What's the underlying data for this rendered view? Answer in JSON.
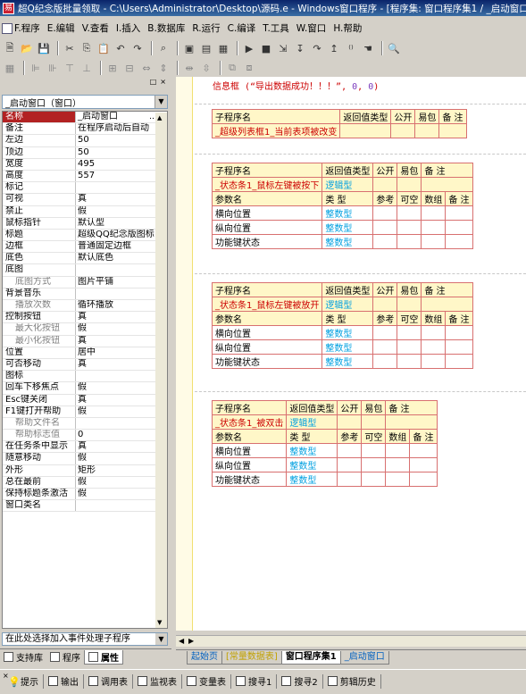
{
  "window": {
    "title": "超Q纪念版批量领取 - C:\\Users\\Administrator\\Desktop\\源码.e - Windows窗口程序 - [程序集: 窗口程序集1 / _启动窗口"
  },
  "menu": [
    {
      "label": "F.程序"
    },
    {
      "label": "E.编辑"
    },
    {
      "label": "V.查看"
    },
    {
      "label": "I.插入"
    },
    {
      "label": "B.数据库"
    },
    {
      "label": "R.运行"
    },
    {
      "label": "C.编译"
    },
    {
      "label": "T.工具"
    },
    {
      "label": "W.窗口"
    },
    {
      "label": "H.帮助"
    }
  ],
  "panel": {
    "combo_value": "_启动窗口（窗口）",
    "event_combo": "在此处选择加入事件处理子程序",
    "properties": [
      {
        "name": "名称",
        "value": "_启动窗口",
        "selected": true,
        "sub": false
      },
      {
        "name": "备注",
        "value": "在程序启动后自动",
        "selected": false,
        "sub": false
      },
      {
        "name": "左边",
        "value": "50",
        "selected": false,
        "sub": false
      },
      {
        "name": "顶边",
        "value": "50",
        "selected": false,
        "sub": false
      },
      {
        "name": "宽度",
        "value": "495",
        "selected": false,
        "sub": false
      },
      {
        "name": "高度",
        "value": "557",
        "selected": false,
        "sub": false
      },
      {
        "name": "标记",
        "value": "",
        "selected": false,
        "sub": false
      },
      {
        "name": "可视",
        "value": "真",
        "selected": false,
        "sub": false
      },
      {
        "name": "禁止",
        "value": "假",
        "selected": false,
        "sub": false
      },
      {
        "name": "鼠标指针",
        "value": "默认型",
        "selected": false,
        "sub": false
      },
      {
        "name": "标题",
        "value": "超级QQ纪念版图标",
        "selected": false,
        "sub": false
      },
      {
        "name": "边框",
        "value": "普通固定边框",
        "selected": false,
        "sub": false
      },
      {
        "name": "底色",
        "value": "默认底色",
        "selected": false,
        "sub": false
      },
      {
        "name": "底图",
        "value": "",
        "selected": false,
        "sub": false
      },
      {
        "name": "底图方式",
        "value": "图片平铺",
        "selected": false,
        "sub": true
      },
      {
        "name": "背景音乐",
        "value": "",
        "selected": false,
        "sub": false
      },
      {
        "name": "播放次数",
        "value": "循环播放",
        "selected": false,
        "sub": true
      },
      {
        "name": "控制按钮",
        "value": "真",
        "selected": false,
        "sub": false
      },
      {
        "name": "最大化按钮",
        "value": "假",
        "selected": false,
        "sub": true
      },
      {
        "name": "最小化按钮",
        "value": "真",
        "selected": false,
        "sub": true
      },
      {
        "name": "位置",
        "value": "居中",
        "selected": false,
        "sub": false
      },
      {
        "name": "可否移动",
        "value": "真",
        "selected": false,
        "sub": false
      },
      {
        "name": "图标",
        "value": "",
        "selected": false,
        "sub": false
      },
      {
        "name": "回车下移焦点",
        "value": "假",
        "selected": false,
        "sub": false
      },
      {
        "name": "Esc键关闭",
        "value": "真",
        "selected": false,
        "sub": false
      },
      {
        "name": "F1键打开帮助",
        "value": "假",
        "selected": false,
        "sub": false
      },
      {
        "name": "帮助文件名",
        "value": "",
        "selected": false,
        "sub": true
      },
      {
        "name": "帮助标志值",
        "value": "0",
        "selected": false,
        "sub": true
      },
      {
        "name": "在任务条中显示",
        "value": "真",
        "selected": false,
        "sub": false
      },
      {
        "name": "随意移动",
        "value": "假",
        "selected": false,
        "sub": false
      },
      {
        "name": "外形",
        "value": "矩形",
        "selected": false,
        "sub": false
      },
      {
        "name": "总在最前",
        "value": "假",
        "selected": false,
        "sub": false
      },
      {
        "name": "保持标题条激活",
        "value": "假",
        "selected": false,
        "sub": false
      },
      {
        "name": "窗口类名",
        "value": "",
        "selected": false,
        "sub": false
      }
    ],
    "tabs": [
      {
        "label": "支持库"
      },
      {
        "label": "程序"
      },
      {
        "label": "属性"
      }
    ]
  },
  "editor": {
    "code_line": {
      "prefix": "信息框 (“导出数据成功！！！”, ",
      "num1": "0",
      "sep": ", ",
      "num2": "0",
      "suffix": ")"
    },
    "header_labels": {
      "sub": "子程序名",
      "ret": "返回值类型",
      "pub": "公开",
      "easy": "易包",
      "note": "备 注"
    },
    "param_labels": {
      "name": "参数名",
      "type": "类 型",
      "ref": "参考",
      "nullable": "可空",
      "array": "数组",
      "note": "备 注"
    },
    "blocks": [
      {
        "sub_name": "_超级列表框1_当前表项被改变",
        "ret_type": "",
        "params": []
      },
      {
        "sub_name": "_状态条1_鼠标左键被按下",
        "ret_type": "逻辑型",
        "params": [
          {
            "name": "横向位置",
            "type": "整数型"
          },
          {
            "name": "纵向位置",
            "type": "整数型"
          },
          {
            "name": "功能键状态",
            "type": "整数型"
          }
        ]
      },
      {
        "sub_name": "_状态条1_鼠标左键被放开",
        "ret_type": "逻辑型",
        "params": [
          {
            "name": "横向位置",
            "type": "整数型"
          },
          {
            "name": "纵向位置",
            "type": "整数型"
          },
          {
            "name": "功能键状态",
            "type": "整数型"
          }
        ]
      },
      {
        "sub_name": "_状态条1_被双击",
        "ret_type": "逻辑型",
        "params": [
          {
            "name": "横向位置",
            "type": "整数型"
          },
          {
            "name": "纵向位置",
            "type": "整数型"
          },
          {
            "name": "功能键状态",
            "type": "整数型"
          }
        ]
      }
    ],
    "doc_tabs": [
      {
        "label": "起始页",
        "style": "start"
      },
      {
        "label": "[常量数据表]",
        "style": "yellow"
      },
      {
        "label": "窗口程序集1",
        "style": "active"
      },
      {
        "label": "_启动窗口",
        "style": "blue"
      }
    ]
  },
  "status_tabs": [
    {
      "label": "提示",
      "icon": "tip-icon"
    },
    {
      "label": "输出",
      "icon": "output-icon"
    },
    {
      "label": "调用表",
      "icon": "call-table-icon"
    },
    {
      "label": "监视表",
      "icon": "watch-icon"
    },
    {
      "label": "变量表",
      "icon": "variable-icon"
    },
    {
      "label": "搜寻1",
      "icon": "search1-icon"
    },
    {
      "label": "搜寻2",
      "icon": "search2-icon"
    },
    {
      "label": "剪辑历史",
      "icon": "clip-history-icon"
    }
  ]
}
